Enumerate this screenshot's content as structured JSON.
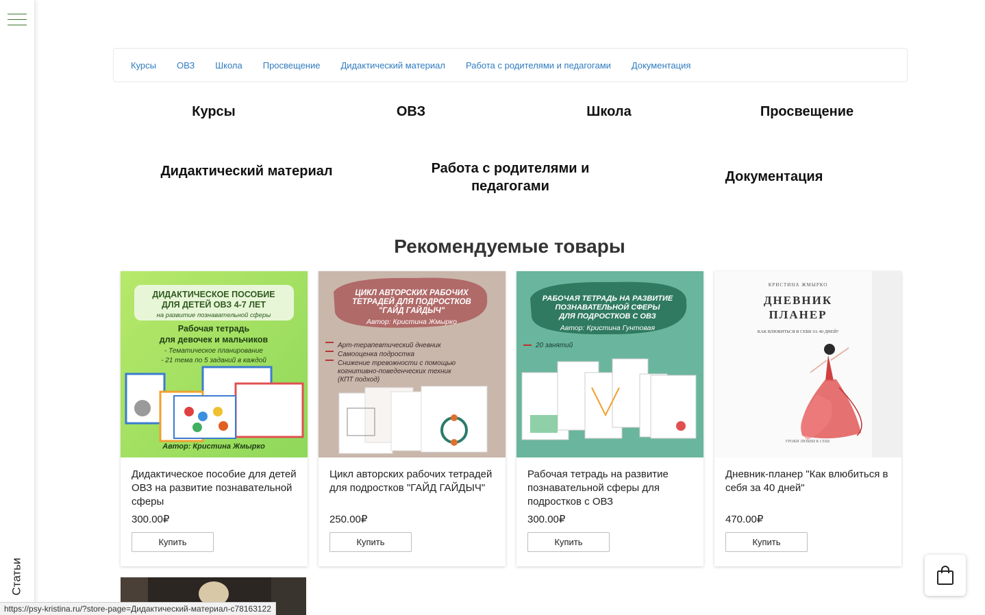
{
  "sidebar": {
    "label": "Статьи"
  },
  "catnav": {
    "items": [
      "Курсы",
      "ОВЗ",
      "Школа",
      "Просвещение",
      "Дидактический материал",
      "Работа с родителями и педагогами",
      "Документация"
    ]
  },
  "categories": {
    "kursy": "Курсы",
    "ovz": "ОВЗ",
    "shkola": "Школа",
    "prosveshchenie": "Просвещение",
    "didaktika": "Дидактический материал",
    "rabota_line1": "Работа с родителями и",
    "rabota_line2": "педагогами",
    "dokumentaciya": "Документация"
  },
  "recommended": {
    "title": "Рекомендуемые товары",
    "buy_label": "Купить",
    "products": [
      {
        "name": "Дидактическое пособие для детей ОВЗ на развитие познавательной сферы",
        "price": "300.00₽",
        "cover": {
          "t1": "ДИДАКТИЧЕСКОЕ ПОСОБИЕ",
          "t2": "ДЛЯ ДЕТЕЙ ОВЗ 4-7 ЛЕТ",
          "t3": "на развитие познавательной сферы",
          "t4": "Рабочая тетрадь",
          "t5": "для девочек и мальчиков",
          "t6": "- Тематическое планирование",
          "t7": "- 21 тема по 5 заданий в каждой",
          "author": "Автор: Кристина Жмырко"
        }
      },
      {
        "name": "Цикл авторских рабочих тетрадей для подростков \"ГАЙД ГАЙДЫЧ\"",
        "price": "250.00₽",
        "cover": {
          "t1": "ЦИКЛ АВТОРСКИХ РАБОЧИХ",
          "t2": "ТЕТРАДЕЙ ДЛЯ ПОДРОСТКОВ",
          "t3": "\"ГАЙД ГАЙДЫЧ\"",
          "author": "Автор: Кристина Жмырко",
          "b1": "Арт-терапевтический дневник",
          "b2": "Самооценка подростка",
          "b3": "Снижение тревожности с помощью",
          "b4": "когнитивно-поведенческих техник",
          "b5": "(КПТ подход)"
        }
      },
      {
        "name": "Рабочая тетрадь на развитие познавательной сферы для подростков с ОВЗ",
        "price": "300.00₽",
        "cover": {
          "t1": "РАБОЧАЯ ТЕТРАДЬ НА РАЗВИТИЕ",
          "t2": "ПОЗНАВАТЕЛЬНОЙ СФЕРЫ",
          "t3": "ДЛЯ ПОДРОСТКОВ С ОВЗ",
          "author": "Автор: Кристина Гунтовая",
          "b1": "20 занятий"
        }
      },
      {
        "name": "Дневник-планер \"Как влюбиться в себя за 40 дней\"",
        "price": "470.00₽",
        "cover": {
          "t0": "КРИСТИНА ЖМЫРКО",
          "t1": "ДНЕВНИК",
          "t2": "ПЛАНЕР",
          "t3": "КАК ВЛЮБИТЬСЯ В СЕБЯ ЗА 40 ДНЕЙ?",
          "t4": "УРОКИ ЛЮБВИ К СЕБЕ"
        }
      }
    ]
  },
  "statusbar": {
    "url": "https://psy-kristina.ru/?store-page=Дидактический-материал-c78163122"
  },
  "colors": {
    "link": "#2f7bbf",
    "burger": "#3a7a2a",
    "card2_bg": "#c9b7ab",
    "card3_bg": "#6ab59d"
  }
}
